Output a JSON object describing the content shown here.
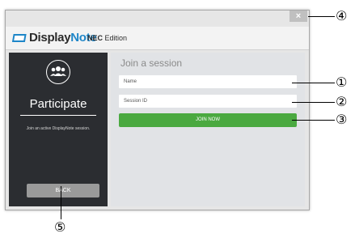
{
  "window": {
    "close_label": "×"
  },
  "header": {
    "brand_display": "Display",
    "brand_note": "Note",
    "brand_nec": "NEC",
    "brand_edition": " Edition",
    "logo_icon": "displaynote-logo-icon"
  },
  "left_panel": {
    "icon": "participants-group-icon",
    "title": "Participate",
    "subtitle": "Join an active DisplayNote session.",
    "back_label": "BACK"
  },
  "right_panel": {
    "title": "Join a session",
    "name_placeholder": "Name",
    "session_placeholder": "Session ID",
    "join_label": "JOIN NOW"
  },
  "callouts": {
    "c1": "①",
    "c2": "②",
    "c3": "③",
    "c4": "④",
    "c5": "⑤"
  },
  "colors": {
    "accent_green": "#4aa940",
    "brand_blue": "#1e86c8",
    "panel_dark": "#2b2d31"
  }
}
